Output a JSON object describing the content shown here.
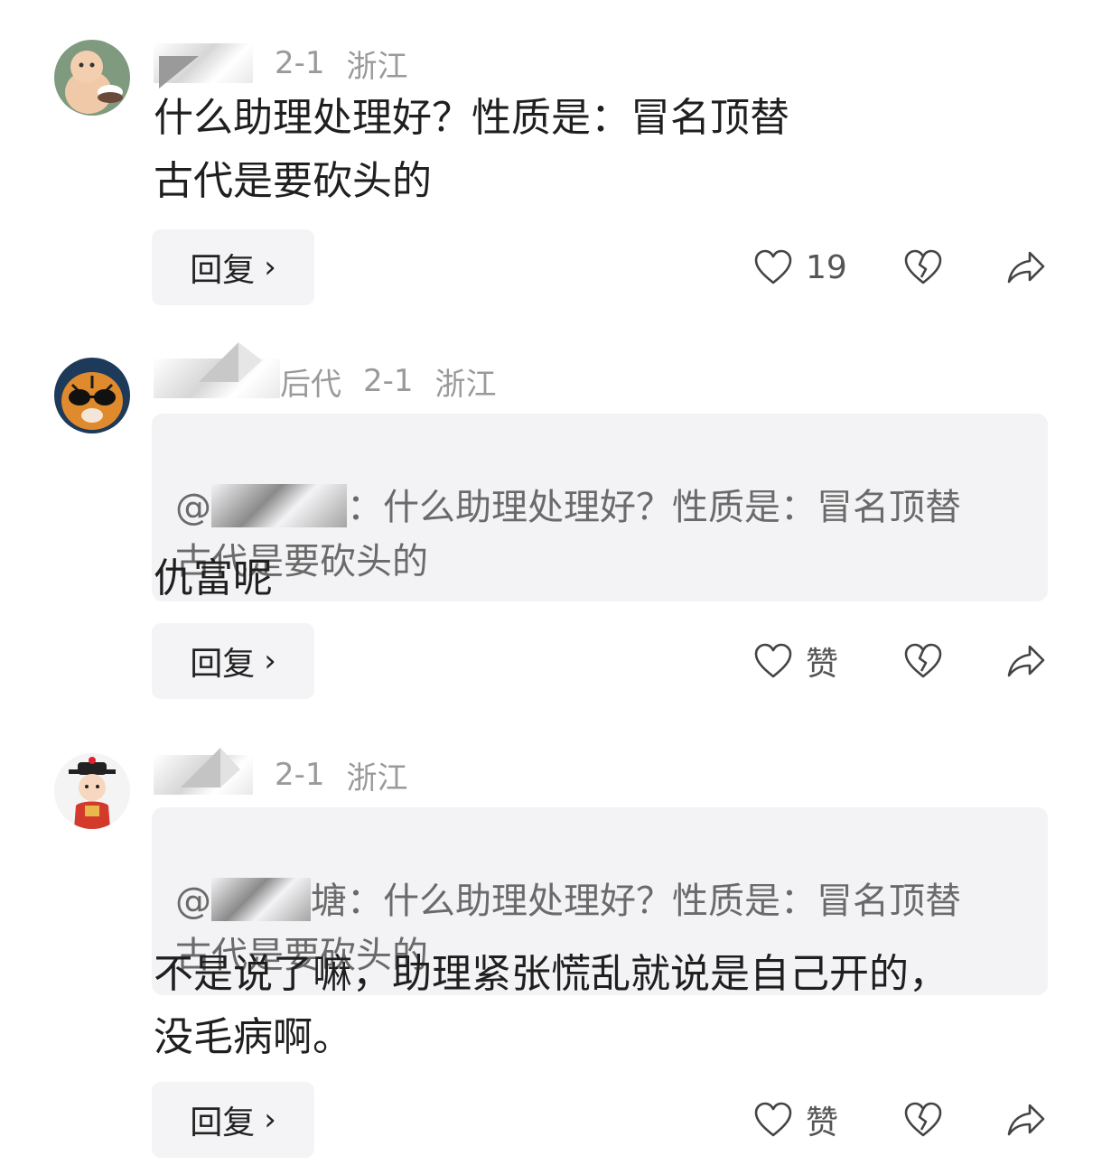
{
  "comments": [
    {
      "user_name": "",
      "date": "2-1",
      "region": "浙江",
      "quote": null,
      "body": "什么助理处理好？性质是：冒名顶替\n古代是要砍头的",
      "reply_label": "回复",
      "like_label": "19"
    },
    {
      "user_name": "后代",
      "date": "2-1",
      "region": "浙江",
      "quote": {
        "prefix": "@",
        "text": "：什么助理处理好？性质是：冒名顶替\n古代是要砍头的"
      },
      "body": "仇富呢",
      "reply_label": "回复",
      "like_label": "赞"
    },
    {
      "user_name": "",
      "date": "2-1",
      "region": "浙江",
      "quote": {
        "prefix": "@",
        "text": "塘：什么助理处理好？性质是：冒名顶替\n古代是要砍头的"
      },
      "body": "不是说了嘛，助理紧张慌乱就说是自己开的，\n没毛病啊。",
      "reply_label": "回复",
      "like_label": "赞"
    }
  ],
  "icons": {
    "like": "heart-outline-icon",
    "dislike": "broken-heart-icon",
    "share": "share-arrow-icon",
    "chevron": "chevron-right-icon"
  },
  "colors": {
    "meta": "#9a9a9a",
    "body": "#1f1f1f",
    "quote_bg": "#f3f3f5",
    "button_bg": "#f4f4f6"
  }
}
